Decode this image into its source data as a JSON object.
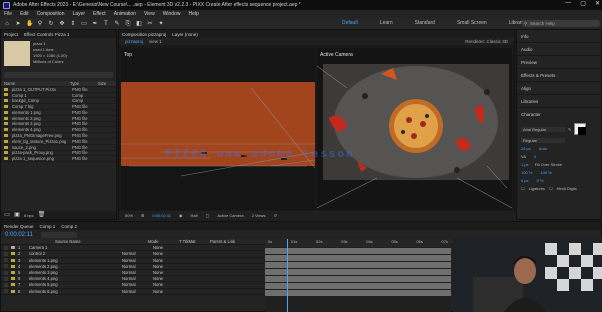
{
  "window": {
    "title": "Adobe After Effects 2023 - E:\\Genesis\\New Course\\... .aep - Element 3D v2.2.3 - PIXX Create After effects sequence project.aep *",
    "controls": [
      "—",
      "▢",
      "✕"
    ]
  },
  "menu": [
    "File",
    "Edit",
    "Composition",
    "Layer",
    "Effect",
    "Animation",
    "View",
    "Window",
    "Help"
  ],
  "workspaces": [
    {
      "label": "Default",
      "active": true
    },
    {
      "label": "Learn",
      "active": false
    },
    {
      "label": "Standard",
      "active": false
    },
    {
      "label": "Small Screen",
      "active": false
    },
    {
      "label": "Libraries",
      "active": false
    }
  ],
  "search": {
    "placeholder": "Search Help"
  },
  "project": {
    "tab": "Project",
    "effect_tab": "Effect Controls Pizza 1",
    "selected": {
      "name": "pizza 1",
      "info": "used 1 time",
      "dims": "1920 × 1080 (1.00)",
      "colors": "Millions of Colors"
    },
    "search_placeholder": "",
    "columns": [
      "Name",
      "Type",
      "Size"
    ],
    "items": [
      {
        "name": "pizza 1_OUTPUT.Pizza",
        "type": "PNG file",
        "size": ""
      },
      {
        "name": "Comp 1",
        "type": "Comp",
        "size": ""
      },
      {
        "name": "backgd_Comp",
        "type": "Comp",
        "size": ""
      },
      {
        "name": "Comp 7 big",
        "type": "PNG file",
        "size": ""
      },
      {
        "name": "elements 1.png",
        "type": "PNG file",
        "size": ""
      },
      {
        "name": "elements 2.png",
        "type": "PNG file",
        "size": ""
      },
      {
        "name": "elements 3.png",
        "type": "PNG file",
        "size": ""
      },
      {
        "name": "elements 4.png",
        "type": "PNG file",
        "size": ""
      },
      {
        "name": "pizza_PNGImageFree.png",
        "type": "PNG file",
        "size": ""
      },
      {
        "name": "elem_bg_texture_Pizza1.png",
        "type": "PNG file",
        "size": ""
      },
      {
        "name": "sauce_2.png",
        "type": "PNG file",
        "size": ""
      },
      {
        "name": "pizza-pack_Proxy.png",
        "type": "PNG file",
        "size": ""
      },
      {
        "name": "pizza 1_sequence.png",
        "type": "PNG file",
        "size": ""
      }
    ],
    "bpc": "8 bpc"
  },
  "composition": {
    "tab": "Composition pizzaproj",
    "layer_tab": "Layer (none)",
    "sub_tabs": [
      "pizzaproj",
      "view 1"
    ],
    "renderer": "Renderer: Classic 3D",
    "left_view": "Top",
    "right_view": "Active Camera",
    "bottom": {
      "zoom": "50%",
      "time": "0:00:02:11",
      "quality": "Half",
      "camera": "Active Camera",
      "views": "2 Views"
    }
  },
  "watermark": "PIZZA www.adobe.lesson",
  "right_panel": {
    "items": [
      "Info",
      "Audio",
      "Preview",
      "Effects & Presets",
      "Align",
      "Libraries",
      "Character"
    ],
    "character": {
      "font": "Arial Regular",
      "style": "Regular",
      "size": "24 px",
      "leading": "Auto",
      "tracking": "0",
      "stroke": "1 px",
      "fill_mode": "Fill Over Stroke",
      "scale_v": "100 %",
      "scale_h": "100 %",
      "baseline": "0 px",
      "tsume": "0 %",
      "ligatures": "Ligatures",
      "hindi": "Hindi Digits"
    }
  },
  "timeline": {
    "tabs": [
      "Render Queue",
      "Comp 1",
      "Comp 2"
    ],
    "time": "0:00:02:11",
    "columns": [
      "Source Name",
      "Mode",
      "T TrkMat",
      "Parent & Link"
    ],
    "layers": [
      {
        "num": "1",
        "name": "Camera 1",
        "mode": "",
        "parent": "None",
        "color": "#c9a0a0"
      },
      {
        "num": "2",
        "name": "control 2",
        "mode": "Normal",
        "parent": "None",
        "color": "#b8a93a"
      },
      {
        "num": "3",
        "name": "elements 1.png",
        "mode": "Normal",
        "parent": "None",
        "color": "#b8a93a"
      },
      {
        "num": "4",
        "name": "elements 2.png",
        "mode": "Normal",
        "parent": "None",
        "color": "#b8a93a"
      },
      {
        "num": "5",
        "name": "elements 3.png",
        "mode": "Normal",
        "parent": "None",
        "color": "#b8a93a"
      },
      {
        "num": "6",
        "name": "elements 4.png",
        "mode": "Normal",
        "parent": "None",
        "color": "#b8a93a"
      },
      {
        "num": "7",
        "name": "elements 5.png",
        "mode": "Normal",
        "parent": "None",
        "color": "#b8a93a"
      },
      {
        "num": "8",
        "name": "elements 6.png",
        "mode": "Normal",
        "parent": "None",
        "color": "#b8a93a"
      }
    ],
    "ruler_marks": [
      "0s",
      "01s",
      "02s",
      "03s",
      "04s",
      "05s",
      "06s",
      "07s"
    ]
  },
  "colors": {
    "accent": "#4aa3ff",
    "comp_bg": "#a2451c",
    "label": "#b8a93a"
  }
}
